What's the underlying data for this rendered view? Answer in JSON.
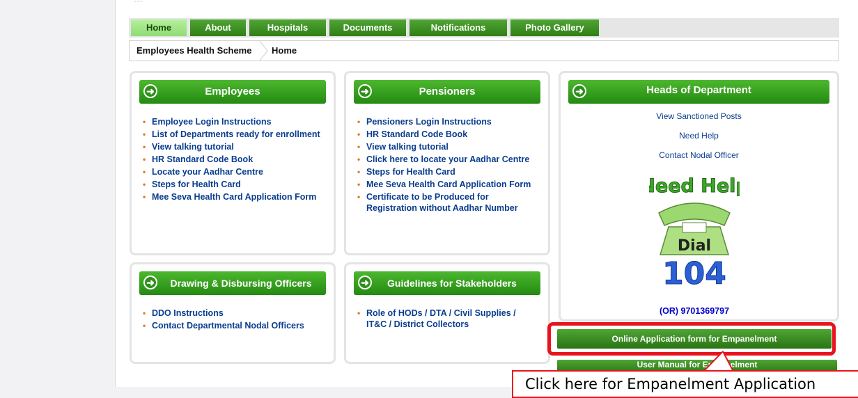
{
  "nav": {
    "tabs": [
      "Home",
      "About",
      "Hospitals",
      "Documents",
      "Notifications",
      "Photo Gallery"
    ],
    "active_index": 0
  },
  "breadcrumb": {
    "items": [
      "Employees Health Scheme",
      "Home"
    ]
  },
  "employees": {
    "title": "Employees",
    "links": [
      "Employee Login Instructions",
      "List of Departments ready for enrollment",
      "View talking tutorial",
      "HR Standard Code Book",
      "Locate your Aadhar Centre",
      "Steps for Health Card",
      "Mee Seva Health Card Application Form"
    ]
  },
  "pensioners": {
    "title": "Pensioners",
    "links": [
      "Pensioners Login Instructions",
      "HR Standard Code Book",
      "View talking tutorial",
      "Click here to locate your Aadhar Centre",
      "Steps for Health Card",
      "Mee Seva Health Card Application Form",
      "Certificate to be Produced for Registration without Aadhar Number"
    ]
  },
  "hod": {
    "title": "Heads of Department",
    "links": [
      "View Sanctioned Posts",
      "Need Help",
      "Contact Nodal Officer"
    ],
    "need_help_image": {
      "top_text": "Need Help",
      "middle_text": "Dial",
      "number": "104"
    },
    "phone_note": "(OR) 9701369797"
  },
  "ddo": {
    "title": "Drawing & Disbursing Officers",
    "links": [
      "DDO Instructions",
      "Contact Departmental Nodal Officers"
    ]
  },
  "guidelines": {
    "title": "Guidelines for Stakeholders",
    "links": [
      "Role of HODs / DTA  / Civil Supplies / IT&C / District Collectors"
    ]
  },
  "buttons": {
    "empanelment": "Online Application form for Empanelment",
    "user_manual": "User Manual for Empanelment"
  },
  "callout": {
    "text": "Click here for Empanelment Application"
  },
  "colors": {
    "nav_green": "#2f7f16",
    "active_tab": "#9be27f",
    "link_blue": "#0a3d8f",
    "bullet_orange": "#e07a1e",
    "highlight_red": "#e8131c"
  }
}
